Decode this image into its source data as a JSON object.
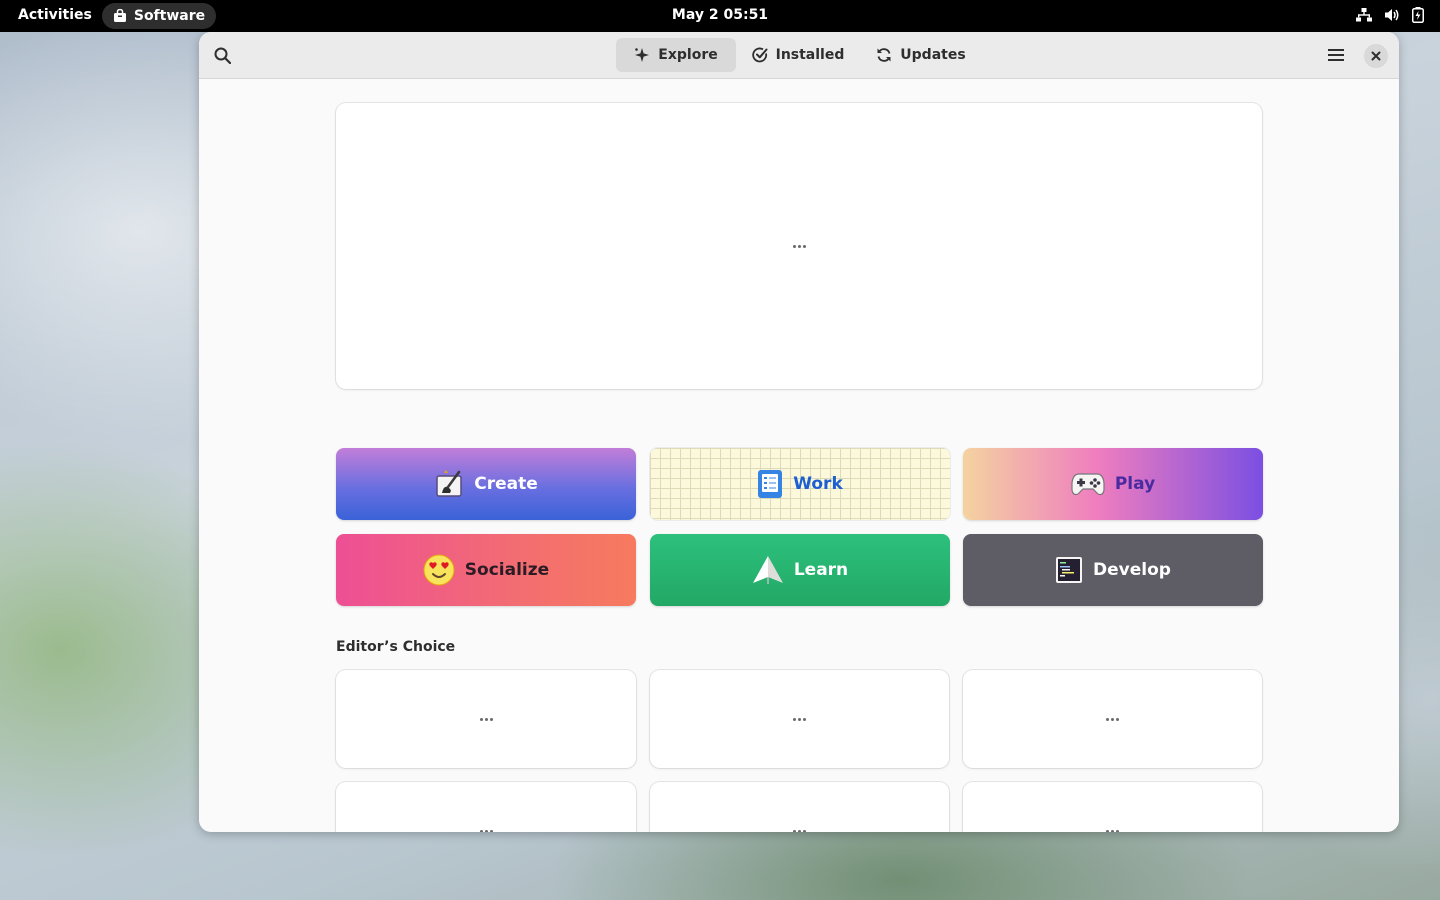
{
  "topbar": {
    "activities": "Activities",
    "app_name": "Software",
    "clock": "May 2  05:51",
    "icons": [
      "network-icon",
      "volume-icon",
      "battery-icon"
    ]
  },
  "window": {
    "tabs": [
      {
        "label": "Explore",
        "icon": "explore-star-icon",
        "active": true
      },
      {
        "label": "Installed",
        "icon": "check-circle-icon",
        "active": false
      },
      {
        "label": "Updates",
        "icon": "refresh-icon",
        "active": false
      }
    ],
    "search_icon": "search-icon",
    "menu_icon": "hamburger-menu-icon",
    "close_icon": "close-icon"
  },
  "featured": {
    "placeholder": "•••"
  },
  "categories": [
    {
      "label": "Create",
      "icon": "create-icon"
    },
    {
      "label": "Work",
      "icon": "work-icon"
    },
    {
      "label": "Play",
      "icon": "gamepad-icon"
    },
    {
      "label": "Socialize",
      "icon": "heart-eyes-emoji-icon"
    },
    {
      "label": "Learn",
      "icon": "paper-plane-icon"
    },
    {
      "label": "Develop",
      "icon": "terminal-icon"
    }
  ],
  "editors_choice": {
    "title": "Editor’s Choice",
    "items": [
      "•••",
      "•••",
      "•••",
      "•••",
      "•••",
      "•••"
    ]
  },
  "colors": {
    "topbar_bg": "#000000",
    "window_bg": "#fafafa",
    "headerbar_bg": "#ebebeb",
    "learn": "#2dc07d",
    "develop": "#5e5c64"
  }
}
